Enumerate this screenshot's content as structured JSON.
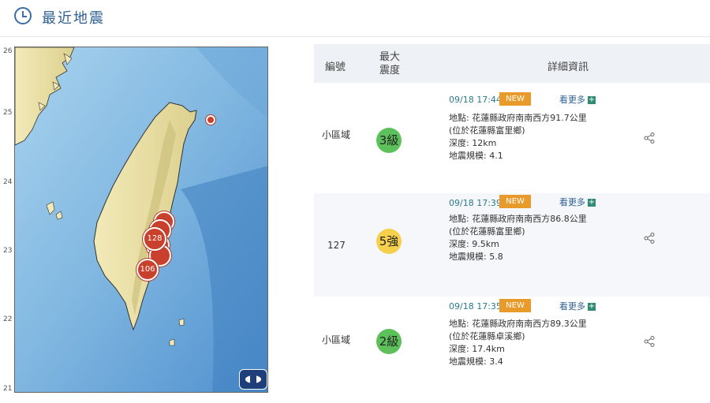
{
  "header": {
    "title": "最近地震"
  },
  "map": {
    "lat_labels": [
      "26",
      "25",
      "24",
      "23",
      "22",
      "21"
    ],
    "markers": [
      {
        "label": "128"
      },
      {
        "label": "106"
      }
    ]
  },
  "table": {
    "headers": {
      "id": "編號",
      "max_intensity": "最大震度",
      "details": "詳細資訊"
    },
    "rows": [
      {
        "id": "小區域",
        "intensity": "3級",
        "badge_color": "#5cc15a",
        "time": "09/18 17:44",
        "new_label": "NEW",
        "more_label": "看更多",
        "location": "地點: 花蓮縣政府南南西方91.7公里",
        "area": "(位於花蓮縣富里鄉)",
        "depth": "深度: 12km",
        "magnitude": "地震規模: 4.1"
      },
      {
        "id": "127",
        "intensity": "5強",
        "badge_color": "#f5d04c",
        "time": "09/18 17:39",
        "new_label": "NEW",
        "more_label": "看更多",
        "location": "地點: 花蓮縣政府南南西方86.8公里",
        "area": "(位於花蓮縣富里鄉)",
        "depth": "深度: 9.5km",
        "magnitude": "地震規模: 5.8"
      },
      {
        "id": "小區域",
        "intensity": "2級",
        "badge_color": "#5cc15a",
        "time": "09/18 17:35",
        "new_label": "NEW",
        "more_label": "看更多",
        "location": "地點: 花蓮縣政府南南西方89.3公里",
        "area": "(位於花蓮縣卓溪鄉)",
        "depth": "深度: 17.4km",
        "magnitude": "地震規模: 3.4"
      }
    ]
  },
  "icons": {
    "header": "clock-icon",
    "share": "share-icon",
    "more": "plus-icon",
    "logo": "cwb-logo-icon"
  }
}
